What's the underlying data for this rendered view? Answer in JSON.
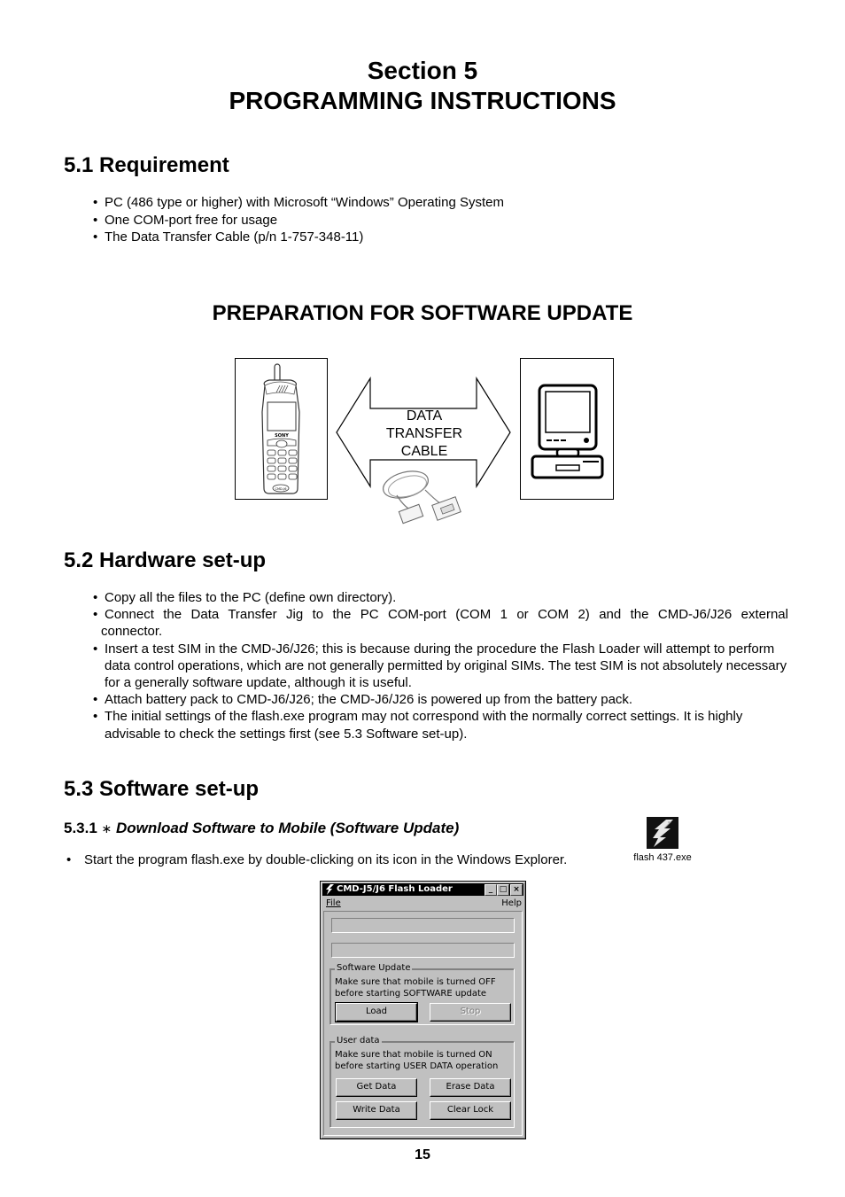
{
  "header": {
    "line1": "Section 5",
    "line2": "PROGRAMMING INSTRUCTIONS"
  },
  "section_5_1": {
    "heading": "5.1 Requirement",
    "items": [
      "PC (486 type or higher) with Microsoft “Windows” Operating System",
      "One COM-port free for usage",
      "The Data Transfer Cable (p/n 1-757-348-11)"
    ]
  },
  "preparation": {
    "heading": "PREPARATION FOR SOFTWARE UPDATE",
    "phone_brand": "SONY",
    "phone_model": "CMD-J6",
    "arrow_label_line1": "DATA",
    "arrow_label_line2": "TRANSFER",
    "arrow_label_line3": "CABLE",
    "icons": [
      "mobile-phone-icon",
      "double-arrow-icon",
      "serial-cable-icon",
      "computer-icon"
    ]
  },
  "section_5_2": {
    "heading": "5.2 Hardware set-up",
    "items": [
      {
        "text": "Copy all the files to the PC (define own directory)."
      },
      {
        "text": "Connect the Data Transfer Jig to the PC COM-port (COM 1 or COM 2) and the CMD-J6/J26 external",
        "cont": "connector."
      },
      {
        "text": "Insert a test SIM in the CMD-J6/J26; this is because during the procedure the Flash Loader will attempt to perform data control operations, which are not generally permitted by original SIMs. The test SIM is not absolutely necessary for a generally software update, although it is useful."
      },
      {
        "text": "Attach battery pack to CMD-J6/J26; the CMD-J6/J26 is powered up from the battery pack."
      },
      {
        "text": "The initial settings of the flash.exe program may not correspond with the normally correct settings. It is highly advisable to check the settings first (see 5.3 Software set-up)."
      }
    ]
  },
  "section_5_3": {
    "heading": "5.3 Software set-up",
    "sub_number": "5.3.1",
    "sub_marker": "∗",
    "sub_title": "Download Software to Mobile (Software Update)",
    "step": "Start the program flash.exe by double-clicking on its icon in the Windows Explorer.",
    "file_icon_label": "flash 437.exe"
  },
  "dialog": {
    "title": "CMD-J5/J6 Flash Loader",
    "title_buttons": {
      "minimize": "_",
      "maximize": "□",
      "close": "×"
    },
    "menu": {
      "file": "File",
      "help": "Help"
    },
    "field1_value": "",
    "field2_value": "",
    "software_update": {
      "label": "Software Update",
      "line1": "Make sure that mobile is turned OFF",
      "line2": "before starting SOFTWARE update",
      "load": "Load",
      "stop": "Stop"
    },
    "user_data": {
      "label": "User data",
      "line1": "Make sure that mobile is turned ON",
      "line2": "before starting USER DATA operation",
      "get_data": "Get Data",
      "erase_data": "Erase Data",
      "write_data": "Write Data",
      "clear_lock": "Clear Lock"
    }
  },
  "footer": {
    "page_number": "15"
  }
}
